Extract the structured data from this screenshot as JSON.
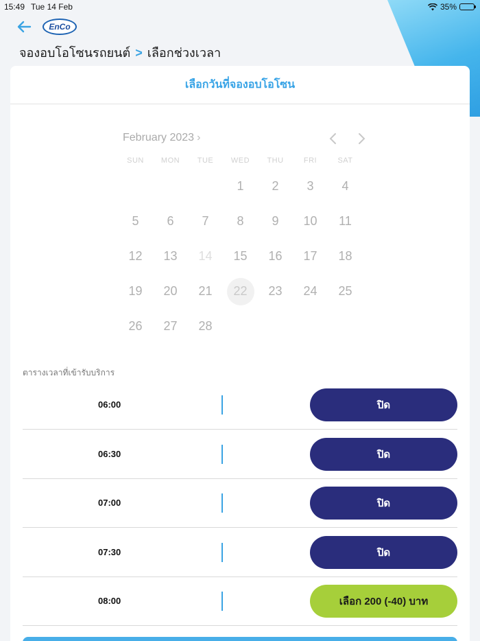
{
  "status": {
    "time": "15:49",
    "date": "Tue 14 Feb",
    "battery": "35%",
    "battery_level": 0.35
  },
  "header": {
    "logo": "EnCo",
    "breadcrumb_parent": "จองอบโอโซนรถยนต์",
    "breadcrumb_sep": ">",
    "breadcrumb_current": "เลือกช่วงเวลา"
  },
  "card": {
    "title": "เลือกวันที่จองอบโอโซน"
  },
  "calendar": {
    "month_label": "February 2023",
    "weekdays": [
      "SUN",
      "MON",
      "TUE",
      "WED",
      "THU",
      "FRI",
      "SAT"
    ],
    "days": [
      "",
      "",
      "",
      "1",
      "2",
      "3",
      "4",
      "5",
      "6",
      "7",
      "8",
      "9",
      "10",
      "11",
      "12",
      "13",
      "14",
      "15",
      "16",
      "17",
      "18",
      "19",
      "20",
      "21",
      "22",
      "23",
      "24",
      "25",
      "26",
      "27",
      "28",
      "",
      "",
      "",
      ""
    ],
    "today": "14",
    "selected": "22"
  },
  "schedule": {
    "title": "ตารางเวลาที่เข้ารับบริการ",
    "slots": [
      {
        "time": "06:00",
        "action": "ปิด",
        "status": "closed"
      },
      {
        "time": "06:30",
        "action": "ปิด",
        "status": "closed"
      },
      {
        "time": "07:00",
        "action": "ปิด",
        "status": "closed"
      },
      {
        "time": "07:30",
        "action": "ปิด",
        "status": "closed"
      },
      {
        "time": "08:00",
        "action": "เลือก 200 (-40) บาท",
        "status": "open"
      }
    ]
  },
  "colors": {
    "accent": "#3aa3e3",
    "closed": "#2a2d7c",
    "open": "#a6cf3a"
  }
}
